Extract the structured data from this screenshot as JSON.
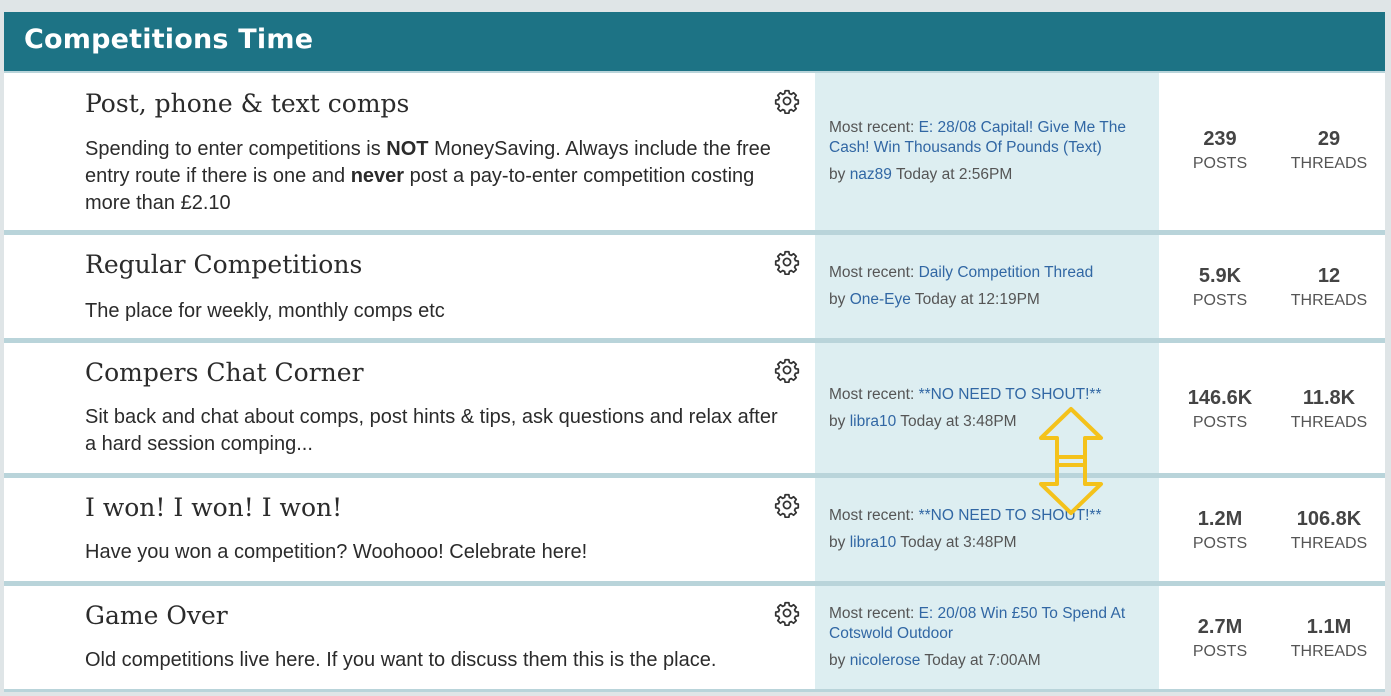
{
  "header": {
    "title": "Competitions Time"
  },
  "forums": [
    {
      "title": "Post, phone & text comps",
      "desc_parts": [
        "Spending to enter competitions is ",
        "NOT",
        " MoneySaving. Always include the free entry route if there is one and ",
        "never",
        " post a pay-to-enter competition costing more than £2.10"
      ],
      "recent_prefix": "Most recent: ",
      "recent_link": "E: 28/08 Capital! Give Me The Cash! Win Thousands Of Pounds (Text)",
      "by_prefix": "by ",
      "by_user": "naz89",
      "time": " Today at 2:56PM",
      "posts": "239",
      "posts_label": "POSTS",
      "threads": "29",
      "threads_label": "THREADS"
    },
    {
      "title": "Regular Competitions",
      "desc": "The place for weekly, monthly comps etc",
      "recent_prefix": "Most recent: ",
      "recent_link": "Daily Competition Thread",
      "by_prefix": "by ",
      "by_user": "One-Eye",
      "time": " Today at 12:19PM",
      "posts": "5.9K",
      "posts_label": "POSTS",
      "threads": "12",
      "threads_label": "THREADS"
    },
    {
      "title": "Compers Chat Corner",
      "desc": "Sit back and chat about comps, post hints & tips, ask questions and relax after a hard session comping...",
      "recent_prefix": "Most recent: ",
      "recent_link": "**NO NEED TO SHOUT!**",
      "by_prefix": "by ",
      "by_user": "libra10",
      "time": " Today at 3:48PM",
      "posts": "146.6K",
      "posts_label": "POSTS",
      "threads": "11.8K",
      "threads_label": "THREADS"
    },
    {
      "title": "I won! I won! I won!",
      "desc": "Have you won a competition? Woohooo! Celebrate here!",
      "recent_prefix": "Most recent: ",
      "recent_link": "**NO NEED TO SHOUT!**",
      "by_prefix": "by ",
      "by_user": "libra10",
      "time": " Today at 3:48PM",
      "posts": "1.2M",
      "posts_label": "POSTS",
      "threads": "106.8K",
      "threads_label": "THREADS"
    },
    {
      "title": "Game Over",
      "desc": "Old competitions live here. If you want to discuss them this is the place.",
      "recent_prefix": "Most recent: ",
      "recent_link": "E: 20/08 Win £50 To Spend At Cotswold Outdoor",
      "by_prefix": "by ",
      "by_user": "nicolerose",
      "time": " Today at 7:00AM",
      "posts": "2.7M",
      "posts_label": "POSTS",
      "threads": "1.1M",
      "threads_label": "THREADS"
    }
  ],
  "icons": {
    "settings": "gear-icon",
    "annotation": "double-arrow-icon"
  },
  "colors": {
    "header": "#1d7385",
    "link": "#3167a4",
    "recent_bg": "#ddeef1",
    "arrow": "#f4c21b"
  }
}
